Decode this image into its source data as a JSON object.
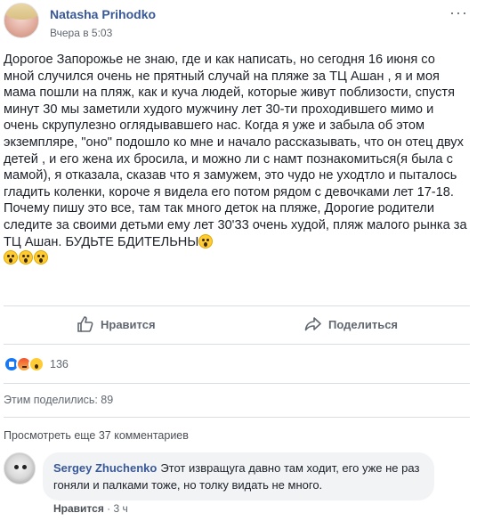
{
  "post": {
    "author": "Natasha Prihodko",
    "time": "Вчера в 5:03",
    "more": "···",
    "paragraphs": [
      "Дорогое Запорожье не знаю, где и как написать, но сегодня 16 июня со мной случился очень не прятный случай на пляже за ТЦ Ашан , я и моя мама пошли на пляж, как и куча людей, которые живут поблизости, спустя минут 30 мы заметили худого мужчину лет 30-ти проходившего мимо и очень скрупулезно оглядывавшего нас. Когда я уже и забыла об этом экземпляре, \"оно\" подошло ко мне и начало рассказывать, что он отец двух детей , и его жена их бросила, и можно ли с намт познакомиться(я была с мамой), я отказала, сказав что я замужем, это чудо не уходтло и пыталось гладить коленки, короче я видела его потом рядом с девочками лет 17-18. Почему пишу это все, там так много деток на пляже, Дорогие родители следите за своими детьми ему лет 30'33 очень худой, пляж малого рынка за ТЦ Ашан. БУДЬТЕ БДИТЕЛЬНЫ"
    ]
  },
  "actions": {
    "like_label": "Нравится",
    "share_label": "Поделиться"
  },
  "reactions": {
    "types": [
      "like-icon",
      "angry-icon",
      "wow-icon"
    ],
    "count": "136"
  },
  "shares": "Этим поделились: 89",
  "more_comments": "Просмотреть еще 37 комментариев",
  "comment": {
    "author": "Sergey Zhuchenko",
    "text": "Этот извращуга давно там ходит, его уже не раз гоняли и палками тоже, но толку видать не много.",
    "like_label": "Нравится",
    "separator": "·",
    "time": "3 ч"
  },
  "colors": {
    "link": "#385898",
    "meta": "#606770",
    "text": "#1d2129",
    "divider": "#dadde1",
    "bubble": "#f2f3f5"
  }
}
